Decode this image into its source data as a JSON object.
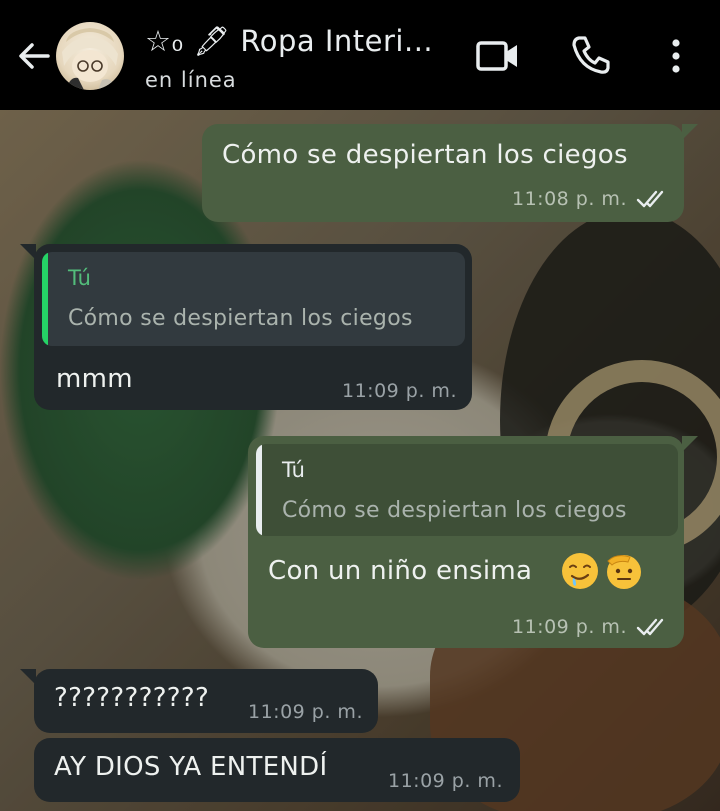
{
  "header": {
    "title": "☆₀ 🖋 Ropa Interi...",
    "status": "en línea",
    "back_icon": "arrow-left-icon",
    "video_icon": "video-camera-icon",
    "call_icon": "phone-icon",
    "menu_icon": "vertical-dots-icon"
  },
  "messages": [
    {
      "direction": "outgoing",
      "text": "Cómo se despiertan los ciegos",
      "time": "11:08 p. m.",
      "read": true
    },
    {
      "direction": "incoming",
      "quote": {
        "author": "Tú",
        "text": "Cómo se despiertan los ciegos"
      },
      "text": "mmm",
      "time": "11:09 p. m."
    },
    {
      "direction": "outgoing",
      "quote": {
        "author": "Tú",
        "text": "Cómo se despiertan los ciegos"
      },
      "text": "Con un niño ensima",
      "emojis": [
        "drooling-face-icon",
        "saluting-face-icon"
      ],
      "time": "11:09 p. m.",
      "read": true
    },
    {
      "direction": "incoming",
      "text": "???????????",
      "time": "11:09 p. m."
    },
    {
      "direction": "incoming",
      "text": "AY DIOS YA ENTENDÍ",
      "time": "11:09 p. m."
    }
  ],
  "colors": {
    "outgoing_bubble": "#4b5f42",
    "incoming_bubble": "#22282b",
    "quote_bar_incoming": "#25d366",
    "quote_author_incoming": "#53bd7b",
    "quote_bar_outgoing": "#e9edef",
    "read_ticks": "#e9edef"
  }
}
